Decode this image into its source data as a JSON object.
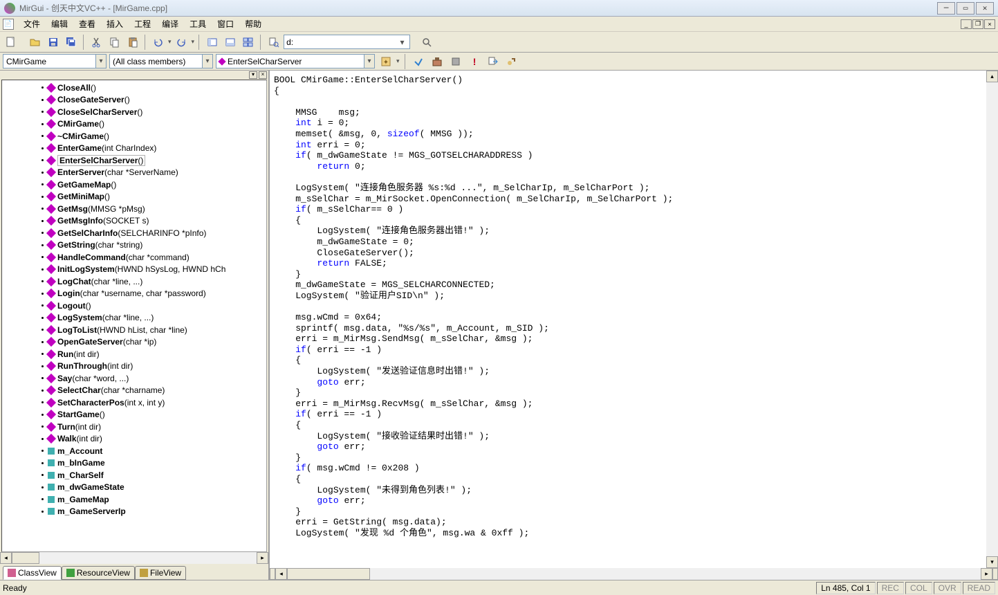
{
  "title": "MirGui - 创天中文VC++ - [MirGame.cpp]",
  "menu": [
    "文件",
    "编辑",
    "查看",
    "插入",
    "工程",
    "编译",
    "工具",
    "窗口",
    "帮助"
  ],
  "toolbar_path": "d:",
  "nav": {
    "class": "CMirGame",
    "filter": "(All class members)",
    "func": "EnterSelCharServer"
  },
  "tree": [
    {
      "t": "f",
      "n": "CloseAll()"
    },
    {
      "t": "f",
      "n": "CloseGateServer()"
    },
    {
      "t": "f",
      "n": "CloseSelCharServer()"
    },
    {
      "t": "f",
      "n": "CMirGame()"
    },
    {
      "t": "f",
      "n": "~CMirGame()"
    },
    {
      "t": "f",
      "n": "EnterGame(int CharIndex)"
    },
    {
      "t": "f",
      "n": "EnterSelCharServer()",
      "sel": true
    },
    {
      "t": "f",
      "n": "EnterServer(char *ServerName)"
    },
    {
      "t": "f",
      "n": "GetGameMap()"
    },
    {
      "t": "f",
      "n": "GetMiniMap()"
    },
    {
      "t": "f",
      "n": "GetMsg(MMSG *pMsg)"
    },
    {
      "t": "f",
      "n": "GetMsgInfo(SOCKET s)"
    },
    {
      "t": "f",
      "n": "GetSelCharInfo(SELCHARINFO *pInfo)"
    },
    {
      "t": "f",
      "n": "GetString(char *string)"
    },
    {
      "t": "f",
      "n": "HandleCommand(char *command)"
    },
    {
      "t": "f",
      "n": "InitLogSystem(HWND hSysLog, HWND hCh"
    },
    {
      "t": "f",
      "n": "LogChat(char *line, ...)"
    },
    {
      "t": "f",
      "n": "Login(char *username, char *password)"
    },
    {
      "t": "f",
      "n": "Logout()"
    },
    {
      "t": "f",
      "n": "LogSystem(char *line, ...)"
    },
    {
      "t": "f",
      "n": "LogToList(HWND hList, char *line)"
    },
    {
      "t": "f",
      "n": "OpenGateServer(char *ip)"
    },
    {
      "t": "f",
      "n": "Run(int dir)"
    },
    {
      "t": "f",
      "n": "RunThrough(int dir)"
    },
    {
      "t": "f",
      "n": "Say(char *word, ...)"
    },
    {
      "t": "f",
      "n": "SelectChar(char *charname)"
    },
    {
      "t": "f",
      "n": "SetCharacterPos(int x, int y)"
    },
    {
      "t": "f",
      "n": "StartGame()"
    },
    {
      "t": "f",
      "n": "Turn(int dir)"
    },
    {
      "t": "f",
      "n": "Walk(int dir)"
    },
    {
      "t": "v",
      "n": "m_Account"
    },
    {
      "t": "v",
      "n": "m_bInGame"
    },
    {
      "t": "v",
      "n": "m_CharSelf"
    },
    {
      "t": "v",
      "n": "m_dwGameState"
    },
    {
      "t": "v",
      "n": "m_GameMap"
    },
    {
      "t": "v",
      "n": "m_GameServerIp"
    }
  ],
  "viewtabs": [
    {
      "l": "ClassView",
      "active": true
    },
    {
      "l": "ResourceView"
    },
    {
      "l": "FileView"
    }
  ],
  "code_lines": [
    {
      "s": [
        [
          "p",
          "BOOL CMirGame::EnterSelCharServer()"
        ]
      ]
    },
    {
      "s": [
        [
          "p",
          "{"
        ]
      ]
    },
    {
      "s": [
        [
          "p",
          ""
        ]
      ]
    },
    {
      "s": [
        [
          "p",
          "    MMSG    msg;"
        ]
      ]
    },
    {
      "s": [
        [
          "p",
          "    "
        ],
        [
          "k",
          "int"
        ],
        [
          "p",
          " i = 0;"
        ]
      ]
    },
    {
      "s": [
        [
          "p",
          "    memset( &msg, 0, "
        ],
        [
          "k",
          "sizeof"
        ],
        [
          "p",
          "( MMSG ));"
        ]
      ]
    },
    {
      "s": [
        [
          "p",
          "    "
        ],
        [
          "k",
          "int"
        ],
        [
          "p",
          " erri = 0;"
        ]
      ]
    },
    {
      "s": [
        [
          "p",
          "    "
        ],
        [
          "k",
          "if"
        ],
        [
          "p",
          "( m_dwGameState != MGS_GOTSELCHARADDRESS )"
        ]
      ]
    },
    {
      "s": [
        [
          "p",
          "        "
        ],
        [
          "k",
          "return"
        ],
        [
          "p",
          " 0;"
        ]
      ]
    },
    {
      "s": [
        [
          "p",
          ""
        ]
      ]
    },
    {
      "s": [
        [
          "p",
          "    LogSystem( \"连接角色服务器 %s:%d ...\", m_SelCharIp, m_SelCharPort );"
        ]
      ]
    },
    {
      "s": [
        [
          "p",
          "    m_sSelChar = m_MirSocket.OpenConnection( m_SelCharIp, m_SelCharPort );"
        ]
      ]
    },
    {
      "s": [
        [
          "p",
          "    "
        ],
        [
          "k",
          "if"
        ],
        [
          "p",
          "( m_sSelChar== 0 )"
        ]
      ]
    },
    {
      "s": [
        [
          "p",
          "    {"
        ]
      ]
    },
    {
      "s": [
        [
          "p",
          "        LogSystem( \"连接角色服务器出错!\" );"
        ]
      ]
    },
    {
      "s": [
        [
          "p",
          "        m_dwGameState = 0;"
        ]
      ]
    },
    {
      "s": [
        [
          "p",
          "        CloseGateServer();"
        ]
      ]
    },
    {
      "s": [
        [
          "p",
          "        "
        ],
        [
          "k",
          "return"
        ],
        [
          "p",
          " FALSE;"
        ]
      ]
    },
    {
      "s": [
        [
          "p",
          "    }"
        ]
      ]
    },
    {
      "s": [
        [
          "p",
          "    m_dwGameState = MGS_SELCHARCONNECTED;"
        ]
      ]
    },
    {
      "s": [
        [
          "p",
          "    LogSystem( \"验证用户SID\\n\" );"
        ]
      ]
    },
    {
      "s": [
        [
          "p",
          ""
        ]
      ]
    },
    {
      "s": [
        [
          "p",
          "    msg.wCmd = 0x64;"
        ]
      ]
    },
    {
      "s": [
        [
          "p",
          "    sprintf( msg.data, \"%s/%s\", m_Account, m_SID );"
        ]
      ]
    },
    {
      "s": [
        [
          "p",
          "    erri = m_MirMsg.SendMsg( m_sSelChar, &msg );"
        ]
      ]
    },
    {
      "s": [
        [
          "p",
          "    "
        ],
        [
          "k",
          "if"
        ],
        [
          "p",
          "( erri == -1 )"
        ]
      ]
    },
    {
      "s": [
        [
          "p",
          "    {"
        ]
      ]
    },
    {
      "s": [
        [
          "p",
          "        LogSystem( \"发送验证信息时出错!\" );"
        ]
      ]
    },
    {
      "s": [
        [
          "p",
          "        "
        ],
        [
          "k",
          "goto"
        ],
        [
          "p",
          " err;"
        ]
      ]
    },
    {
      "s": [
        [
          "p",
          "    }"
        ]
      ]
    },
    {
      "s": [
        [
          "p",
          "    erri = m_MirMsg.RecvMsg( m_sSelChar, &msg );"
        ]
      ]
    },
    {
      "s": [
        [
          "p",
          "    "
        ],
        [
          "k",
          "if"
        ],
        [
          "p",
          "( erri == -1 )"
        ]
      ]
    },
    {
      "s": [
        [
          "p",
          "    {"
        ]
      ]
    },
    {
      "s": [
        [
          "p",
          "        LogSystem( \"接收验证结果时出错!\" );"
        ]
      ]
    },
    {
      "s": [
        [
          "p",
          "        "
        ],
        [
          "k",
          "goto"
        ],
        [
          "p",
          " err;"
        ]
      ]
    },
    {
      "s": [
        [
          "p",
          "    }"
        ]
      ]
    },
    {
      "s": [
        [
          "p",
          "    "
        ],
        [
          "k",
          "if"
        ],
        [
          "p",
          "( msg.wCmd != 0x208 )"
        ]
      ]
    },
    {
      "s": [
        [
          "p",
          "    {"
        ]
      ]
    },
    {
      "s": [
        [
          "p",
          "        LogSystem( \"未得到角色列表!\" );"
        ]
      ]
    },
    {
      "s": [
        [
          "p",
          "        "
        ],
        [
          "k",
          "goto"
        ],
        [
          "p",
          " err;"
        ]
      ]
    },
    {
      "s": [
        [
          "p",
          "    }"
        ]
      ]
    },
    {
      "s": [
        [
          "p",
          "    erri = GetString( msg.data);"
        ]
      ]
    },
    {
      "s": [
        [
          "p",
          "    LogSystem( \"发现 %d 个角色\", msg.wa & 0xff );"
        ]
      ]
    }
  ],
  "status": {
    "ready": "Ready",
    "pos": "Ln 485, Col 1",
    "ind": [
      "REC",
      "COL",
      "OVR",
      "READ"
    ]
  }
}
